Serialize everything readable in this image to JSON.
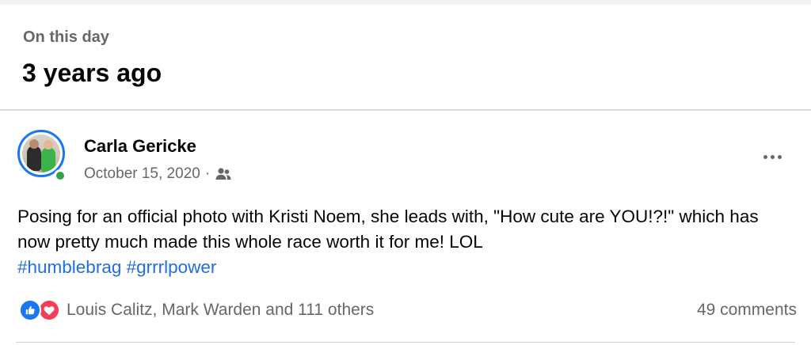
{
  "memory": {
    "eyebrow": "On this day",
    "headline": "3 years ago"
  },
  "post": {
    "author": "Carla Gericke",
    "date": "October 15, 2020",
    "separator": "·",
    "audience_icon": "friends-icon",
    "text_main": "Posing for an official photo with Kristi Noem, she leads with, \"How cute are YOU!?!\" which has now pretty much made this whole race worth it for me! LOL",
    "hashtags": [
      "#humblebrag",
      "#grrrlpower"
    ]
  },
  "engagement": {
    "reactions": [
      "like",
      "love"
    ],
    "reaction_names": "Louis Calitz, Mark Warden and 111 others",
    "comments": "49 comments"
  },
  "colors": {
    "accent": "#1877f2",
    "online": "#31a24c",
    "hashtag": "#216fdb",
    "love": "#f33e58",
    "secondary_text": "#65676b"
  }
}
